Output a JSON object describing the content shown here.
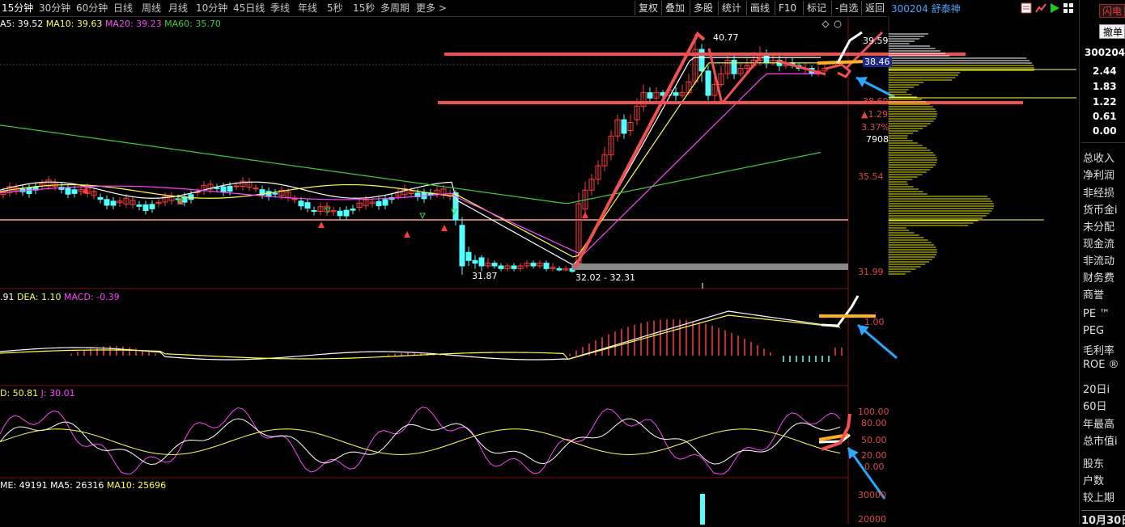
{
  "toolbar": {
    "periods": [
      "15分钟",
      "30分钟",
      "60分钟",
      "日线",
      "周线",
      "月线",
      "10分钟",
      "45日线",
      "季线",
      "年线",
      "5秒",
      "15秒",
      "多周期",
      "更多 >"
    ],
    "tools": [
      "复权",
      "叠加",
      "多股",
      "统计",
      "画线",
      "F10",
      "标记",
      "-自选",
      "返回"
    ],
    "stock_header": "300204 舒泰神"
  },
  "right_panel": {
    "top_buttons": [
      "闪电",
      "撤单"
    ],
    "code": "300204",
    "values": [
      "2.44",
      "1.83",
      "1.22",
      "0.61",
      "0.00"
    ],
    "labels": [
      "总收入",
      "净利润",
      "非经损",
      "货币金i",
      "未分配",
      "现金流",
      "非流动",
      "财务费",
      "商誉",
      "PE ™",
      "PEG",
      "毛利率",
      "ROE ®",
      "20日i",
      "60日",
      "年最高",
      "总市值i",
      "股东",
      "户数",
      "较上期"
    ],
    "date": "10月30日"
  },
  "main_chart": {
    "ma_legend": {
      "ma5": "A5: 39.52",
      "ma10": "MA10: 39.63",
      "ma20": "MA20: 39.23",
      "ma60": "MA60: 35.70"
    },
    "price_axis": [
      "39.59",
      "38.46",
      "38.60",
      "35.54",
      "31.99"
    ],
    "axis_values_small": [
      "▲1.29",
      "3.37%",
      "7908"
    ],
    "high_label": "40.77",
    "low_label_left": "31.87",
    "low_label_right": "32.02 - 32.31",
    "colors": {
      "up": "#ff3c3c",
      "down": "#54ffff",
      "ma5": "#ffffff",
      "ma10": "#ffff4f",
      "ma20": "#ff44ff",
      "ma60": "#3fcf3f",
      "annotation": "#f05050",
      "arrow": "#2aa8ff",
      "highlight": "#ffb020"
    }
  },
  "macd": {
    "legend": {
      "dif": ".91",
      "dea": "DEA: 1.10",
      "macd": "MACD: -0.39"
    },
    "axis": [
      "1.00"
    ]
  },
  "kdj": {
    "legend": {
      "d": "D: 50.81",
      "j": "J: 30.01"
    },
    "axis": [
      "100.00",
      "80.00",
      "50.00",
      "20.00",
      "0.00"
    ]
  },
  "volume": {
    "legend": {
      "vol": "ME: 49191",
      "ma5": "MA5: 26316",
      "ma10": "MA10: 25696"
    },
    "axis": [
      "30000",
      "20000"
    ]
  }
}
